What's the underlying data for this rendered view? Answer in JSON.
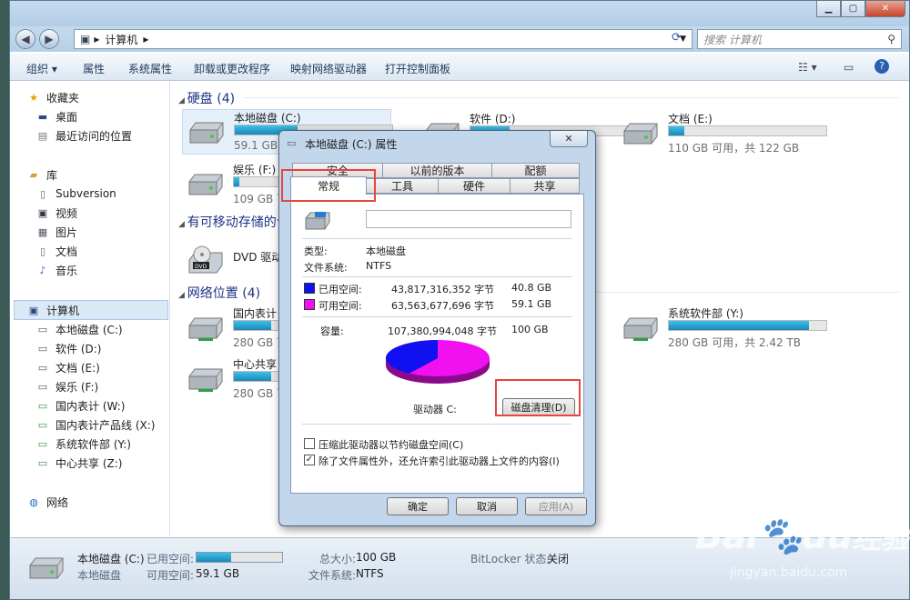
{
  "address": {
    "path": "计算机",
    "search_placeholder": "搜索 计算机"
  },
  "toolbar": {
    "organize": "组织",
    "properties": "属性",
    "system_properties": "系统属性",
    "uninstall": "卸载或更改程序",
    "map_drive": "映射网络驱动器",
    "control_panel": "打开控制面板"
  },
  "sidebar": {
    "favorites": "收藏夹",
    "desktop": "桌面",
    "recent": "最近访问的位置",
    "libraries": "库",
    "subversion": "Subversion",
    "video": "视频",
    "pictures": "图片",
    "documents": "文档",
    "music": "音乐",
    "computer": "计算机",
    "drives": [
      "本地磁盘 (C:)",
      "软件 (D:)",
      "文档 (E:)",
      "娱乐 (F:)",
      "国内表计 (W:)",
      "国内表计产品线 (X:)",
      "系统软件部 (Y:)",
      "中心共享 (Z:)"
    ],
    "network": "网络"
  },
  "content": {
    "hdd_group": "硬盘 (4)",
    "removable_group": "有可移动存储的设",
    "network_group": "网络位置 (4)",
    "drives": [
      {
        "name": "本地磁盘 (C:)",
        "size": "59.1 GB",
        "used_fraction": 0.4
      },
      {
        "name": "软件 (D:)",
        "size": "",
        "used_fraction": 0.25
      },
      {
        "name": "文档 (E:)",
        "size": "110 GB 可用，共 122 GB",
        "used_fraction": 0.1
      },
      {
        "name": "娱乐 (F:)",
        "size": "109 GB 可",
        "used_fraction": 0.1
      },
      {
        "name": "DVD 驱动器",
        "size": ""
      },
      {
        "name": "国内表计 (W",
        "size": "280 GB 可",
        "used_fraction": 0.6
      },
      {
        "name": "中心共享 (Z",
        "size": "280 GB 可",
        "used_fraction": 0.6
      },
      {
        "name": "系统软件部 (Y:)",
        "size": "280 GB 可用，共 2.42 TB",
        "used_fraction": 0.89
      }
    ]
  },
  "details": {
    "name": "本地磁盘 (C:)",
    "type": "本地磁盘",
    "used_label": "已用空间:",
    "used_fraction": 0.4,
    "free_label": "可用空间:",
    "free": "59.1 GB",
    "total_label": "总大小:",
    "total": "100 GB",
    "fs_label": "文件系统:",
    "fs": "NTFS",
    "bitlocker_label": "BitLocker 状态:",
    "bitlocker": "关闭"
  },
  "dialog": {
    "title": "本地磁盘 (C:) 属性",
    "tabs_row1": [
      "安全",
      "以前的版本",
      "配额"
    ],
    "tabs_row2": [
      "常规",
      "工具",
      "硬件",
      "共享"
    ],
    "type_label": "类型:",
    "type": "本地磁盘",
    "fs_label": "文件系统:",
    "fs": "NTFS",
    "used_label": "已用空间:",
    "used_bytes": "43,817,316,352 字节",
    "used_gb": "40.8 GB",
    "free_label": "可用空间:",
    "free_bytes": "63,563,677,696 字节",
    "free_gb": "59.1 GB",
    "cap_label": "容量:",
    "cap_bytes": "107,380,994,048 字节",
    "cap_gb": "100 GB",
    "drive_label": "驱动器 C:",
    "cleanup": "磁盘清理(D)",
    "compress": "压缩此驱动器以节约磁盘空间(C)",
    "index": "除了文件属性外，还允许索引此驱动器上文件的内容(I)",
    "ok": "确定",
    "cancel": "取消",
    "apply": "应用(A)",
    "used_color": "#1010f0",
    "free_color": "#f010f0",
    "used_share": 0.408
  },
  "watermark": {
    "brand": "Bai",
    "brand2": "du",
    "brand3": "经验",
    "url": "jingyan.baidu.com"
  }
}
